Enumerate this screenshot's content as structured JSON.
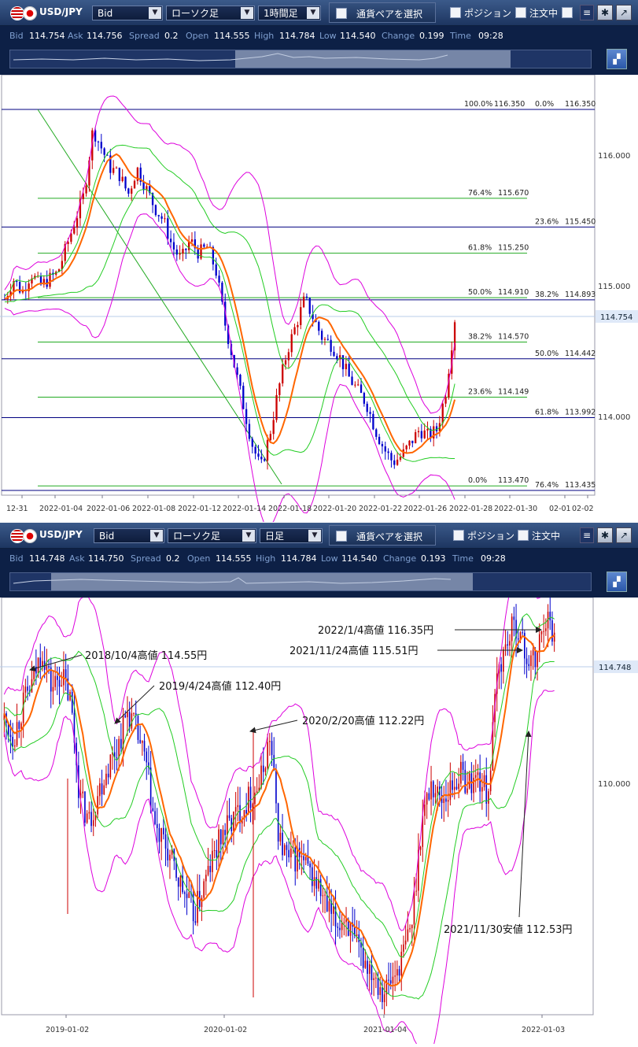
{
  "panels": [
    {
      "toolbar": {
        "pair": "USD/JPY",
        "price_type": "Bid",
        "chart_type": "ローソク足",
        "timeframe": "1時間足",
        "pair_select": "通貨ペアを選択",
        "position": "ポジション",
        "orders": "注文中"
      },
      "quote": {
        "bid_label": "Bid",
        "bid": "114.754",
        "ask_label": "Ask",
        "ask": "114.756",
        "spread_label": "Spread",
        "spread": "0.2",
        "open_label": "Open",
        "open": "114.555",
        "high_label": "High",
        "high": "114.784",
        "low_label": "Low",
        "low": "114.540",
        "change_label": "Change",
        "change": "0.199",
        "time_label": "Time",
        "time": "09:28"
      },
      "chart_data": {
        "type": "candlestick",
        "x_ticks": [
          "12-31",
          "2022-01-04",
          "2022-01-06",
          "2022-01-08",
          "2022-01-12",
          "2022-01-14",
          "2022-01-18",
          "2022-01-20",
          "2022-01-22",
          "2022-01-26",
          "2022-01-28",
          "2022-01-30",
          "02-01",
          "02-02"
        ],
        "y_ticks": [
          "116.000",
          "115.000",
          "114.000"
        ],
        "ylim": [
          113.35,
          116.5
        ],
        "current_price": "114.754",
        "fib_levels": [
          {
            "label": "100.0%",
            "value": "116.350",
            "color": "#00008b"
          },
          {
            "label": "0.0%",
            "value": "116.350",
            "color": "#00008b"
          },
          {
            "label": "76.4%",
            "value": "115.670",
            "color": "#00aa00"
          },
          {
            "label": "23.6%",
            "value": "115.450",
            "color": "#00008b"
          },
          {
            "label": "61.8%",
            "value": "115.250",
            "color": "#00aa00"
          },
          {
            "label": "50.0%",
            "value": "114.910",
            "color": "#00aa00"
          },
          {
            "label": "38.2%",
            "value": "114.893",
            "color": "#00008b"
          },
          {
            "label": "38.2%",
            "value": "114.570",
            "color": "#00aa00"
          },
          {
            "label": "50.0%",
            "value": "114.442",
            "color": "#00008b"
          },
          {
            "label": "23.6%",
            "value": "114.149",
            "color": "#00aa00"
          },
          {
            "label": "61.8%",
            "value": "113.992",
            "color": "#00008b"
          },
          {
            "label": "0.0%",
            "value": "113.470",
            "color": "#00aa00"
          },
          {
            "label": "76.4%",
            "value": "113.435",
            "color": "#00008b"
          }
        ],
        "price_path": [
          114.9,
          115.05,
          114.95,
          115.1,
          115.0,
          115.05,
          115.1,
          115.3,
          115.5,
          115.7,
          116.2,
          116.05,
          115.9,
          115.85,
          115.7,
          115.9,
          115.75,
          115.6,
          115.5,
          115.3,
          115.2,
          115.35,
          115.25,
          115.3,
          115.1,
          114.7,
          114.4,
          114.1,
          113.8,
          113.6,
          113.85,
          114.2,
          114.5,
          114.7,
          114.9,
          114.75,
          114.6,
          114.55,
          114.45,
          114.3,
          114.2,
          114.1,
          113.9,
          113.75,
          113.65,
          113.7,
          113.8,
          113.9,
          113.85,
          113.9,
          114.2,
          114.75
        ]
      }
    },
    {
      "toolbar": {
        "pair": "USD/JPY",
        "price_type": "Bid",
        "chart_type": "ローソク足",
        "timeframe": "日足",
        "pair_select": "通貨ペアを選択",
        "position": "ポジション",
        "orders": "注文中"
      },
      "quote": {
        "bid_label": "Bid",
        "bid": "114.748",
        "ask_label": "Ask",
        "ask": "114.750",
        "spread_label": "Spread",
        "spread": "0.2",
        "open_label": "Open",
        "open": "114.555",
        "high_label": "High",
        "high": "114.784",
        "low_label": "Low",
        "low": "114.540",
        "change_label": "Change",
        "change": "0.193",
        "time_label": "Time",
        "time": "09:28"
      },
      "chart_data": {
        "type": "candlestick",
        "x_ticks": [
          "2019-01-02",
          "2020-01-02",
          "2021-01-04",
          "2022-01-03"
        ],
        "y_ticks": [
          "110.000"
        ],
        "ylim": [
          101.0,
          117.5
        ],
        "current_price": "114.748",
        "annotations": [
          "2022/1/4高値 116.35円",
          "2021/11/24高値 115.51円",
          "2018/10/4高値 114.55円",
          "2019/4/24高値 112.40円",
          "2020/2/20高値 112.22円",
          "2021/11/30安値 112.53円"
        ],
        "price_path": [
          112.0,
          111.5,
          112.5,
          113.2,
          114.3,
          113.0,
          113.5,
          112.6,
          109.5,
          108.8,
          109.8,
          110.6,
          111.2,
          112.3,
          111.6,
          110.5,
          108.4,
          108.0,
          107.2,
          106.5,
          105.8,
          106.7,
          107.6,
          108.4,
          108.8,
          109.2,
          109.6,
          110.0,
          111.5,
          108.2,
          107.5,
          107.7,
          107.2,
          106.8,
          106.0,
          105.5,
          105.8,
          104.8,
          104.4,
          104.0,
          103.4,
          103.8,
          104.5,
          105.6,
          108.8,
          110.0,
          109.5,
          109.8,
          110.3,
          110.0,
          110.2,
          109.6,
          113.5,
          114.5,
          115.1,
          114.0,
          113.8,
          115.4,
          114.7
        ]
      }
    }
  ]
}
